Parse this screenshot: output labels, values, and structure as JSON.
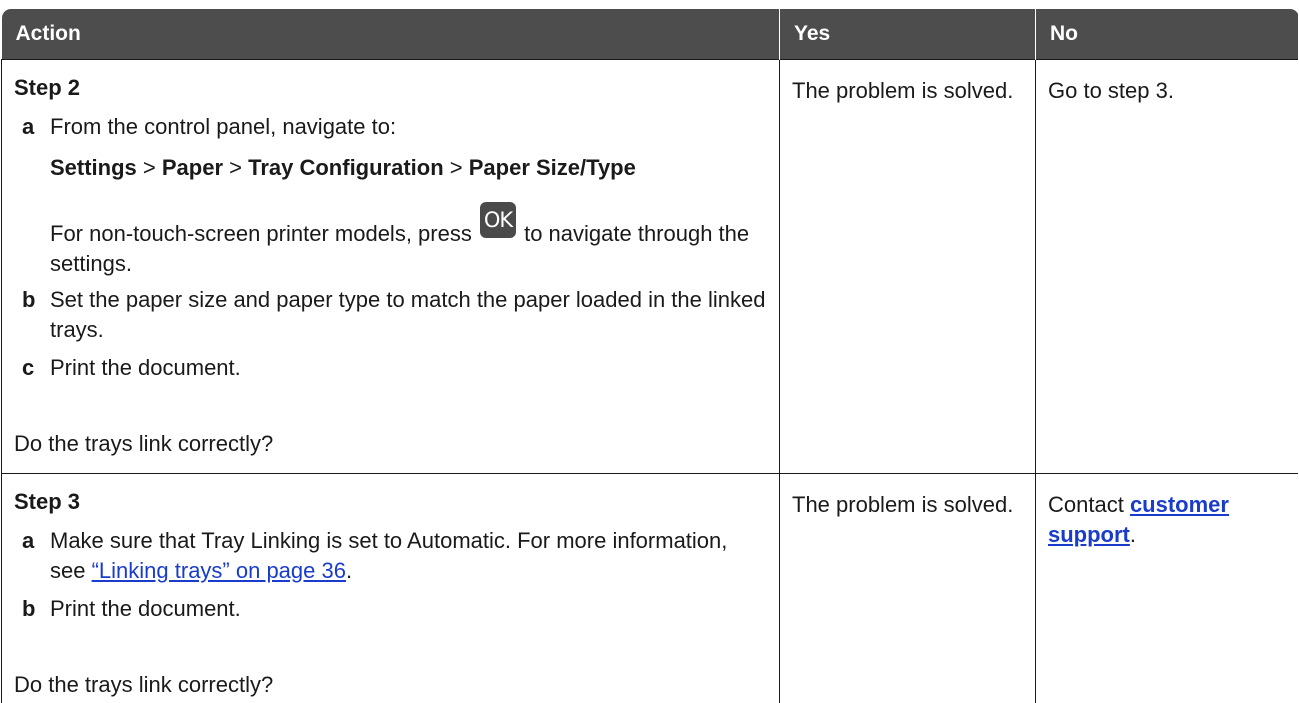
{
  "header": {
    "action": "Action",
    "yes": "Yes",
    "no": "No"
  },
  "step2": {
    "title": "Step 2",
    "a_letter": "a",
    "a_text": "From the control panel, navigate to:",
    "path": {
      "settings": "Settings",
      "sep1": " > ",
      "paper": "Paper",
      "sep2": " > ",
      "tray_config": "Tray Configuration",
      "sep3": " > ",
      "paper_size_type": "Paper Size/Type"
    },
    "note_before": "For non-touch-screen printer models, press ",
    "ok_label": "OK",
    "note_after": " to navigate through the settings.",
    "b_letter": "b",
    "b_text": "Set the paper size and paper type to match the paper loaded in the linked trays.",
    "c_letter": "c",
    "c_text": "Print the document.",
    "question": "Do the trays link correctly?",
    "yes": "The problem is solved.",
    "no": "Go to step 3."
  },
  "step3": {
    "title": "Step 3",
    "a_letter": "a",
    "a_text": "Make sure that Tray Linking is set to Automatic. For more information, see ",
    "a_link": "“Linking trays” on page 36",
    "a_end": ".",
    "b_letter": "b",
    "b_text": "Print the document.",
    "question": "Do the trays link correctly?",
    "yes": "The problem is solved.",
    "no_prefix": "Contact ",
    "no_link": "customer support",
    "no_suffix": "."
  }
}
